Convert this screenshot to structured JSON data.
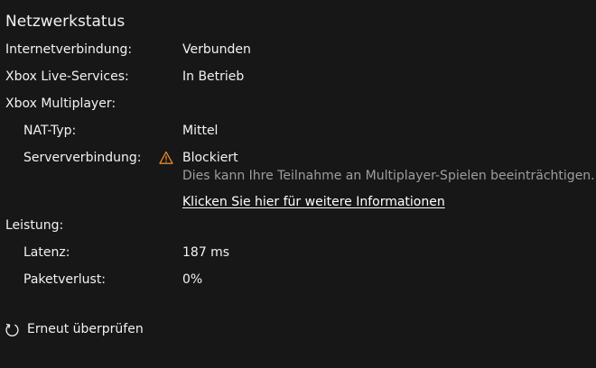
{
  "title": "Netzwerkstatus",
  "rows": {
    "internet": {
      "label": "Internetverbindung:",
      "value": "Verbunden"
    },
    "xbox_live": {
      "label": "Xbox Live-Services:",
      "value": "In Betrieb"
    },
    "multiplayer": {
      "label": "Xbox Multiplayer:"
    },
    "nat": {
      "label": "NAT-Typ:",
      "value": "Mittel"
    },
    "server": {
      "label": "Serververbindung:",
      "value": "Blockiert",
      "description": "Dies kann Ihre Teilnahme an Multiplayer-Spielen beeinträchtigen.",
      "link": "Klicken Sie hier für weitere Informationen",
      "status_icon": "warning-icon",
      "status_color": "#e8892b"
    },
    "performance": {
      "label": "Leistung:"
    },
    "latency": {
      "label": "Latenz:",
      "value": "187 ms"
    },
    "packet_loss": {
      "label": "Paketverlust:",
      "value": "0%"
    }
  },
  "actions": {
    "recheck": {
      "label": "Erneut überprüfen",
      "icon": "refresh-icon"
    }
  },
  "colors": {
    "background": "#171717",
    "text": "#f2f2f2",
    "secondary_text": "#9e9e9e",
    "warning": "#e8892b"
  }
}
